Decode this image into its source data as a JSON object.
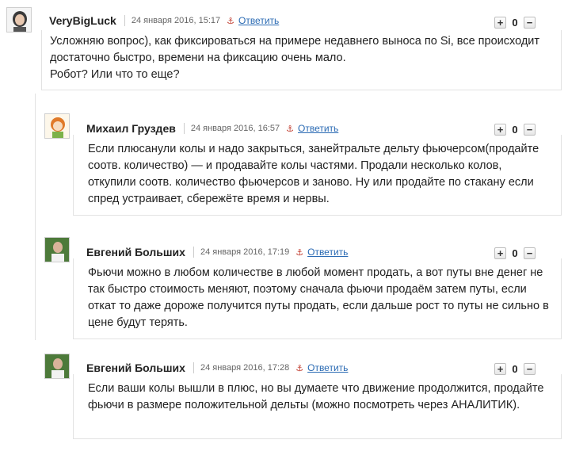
{
  "comments": [
    {
      "author": "VeryBigLuck",
      "date": "24 января 2016, 15:17",
      "reply": "Ответить",
      "anchor": "⚓",
      "plus": "+",
      "minus": "−",
      "score": "0",
      "text": "Усложняю вопрос), как фиксироваться на примере недавнего выноса по Si, все происходит достаточно быстро, времени на фиксацию очень мало.\nРобот? Или что то еще?"
    },
    {
      "author": "Михаил Груздев",
      "date": "24 января 2016, 16:57",
      "reply": "Ответить",
      "anchor": "⚓",
      "plus": "+",
      "minus": "−",
      "score": "0",
      "text": "Если плюсанули колы и надо закрыться, занейтральте дельту фьючерсом(продайте соотв. количество) — и продавайте колы частями. Продали несколько колов, откупили соотв. количество фьючерсов и заново. Ну или продайте по стакану если спред устраивает, сбережёте время и нервы."
    },
    {
      "author": "Евгений Больших",
      "date": "24 января 2016, 17:19",
      "reply": "Ответить",
      "anchor": "⚓",
      "plus": "+",
      "minus": "−",
      "score": "0",
      "text": "Фьючи можно в любом количестве в любой момент продать, а вот путы вне денег не так быстро стоимость меняют, поэтому сначала фьючи продаём затем путы, если откат то даже дороже получится путы продать, если дальше рост то путы не сильно в цене будут терять."
    },
    {
      "author": "Евгений Больших",
      "date": "24 января 2016, 17:28",
      "reply": "Ответить",
      "anchor": "⚓",
      "plus": "+",
      "minus": "−",
      "score": "0",
      "text": "Если ваши колы вышли в плюс, но вы думаете что движение продолжится, продайте фьючи в размере положительной дельты (можно посмотреть через АНАЛИТИК)."
    }
  ]
}
